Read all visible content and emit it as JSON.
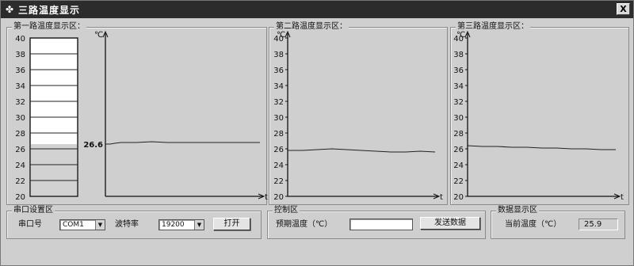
{
  "window": {
    "title": "三路温度显示",
    "close_label": "X",
    "icon": "app-logo-icon"
  },
  "panels": [
    {
      "label": "第一路温度显示区：",
      "unit": "℃",
      "axis_end": "t"
    },
    {
      "label": "第二路温度显示区：",
      "unit": "℃",
      "axis_end": "t"
    },
    {
      "label": "第三路温度显示区：",
      "unit": "℃",
      "axis_end": "t"
    }
  ],
  "thermometer": {
    "ticks": [
      "40",
      "38",
      "36",
      "34",
      "32",
      "30",
      "28",
      "26",
      "24",
      "22",
      "20"
    ],
    "level": 26.6,
    "min": 20,
    "max": 40
  },
  "current_marker": "26.6",
  "serial_settings": {
    "group_label": "串口设置区",
    "port_label": "串口号",
    "port_value": "COM1",
    "baud_label": "波特率",
    "baud_value": "19200",
    "open_button": "打开"
  },
  "control": {
    "group_label": "控制区",
    "setpoint_label": "预期温度（℃）",
    "setpoint_value": "",
    "send_button": "发送数据"
  },
  "data_display": {
    "group_label": "数据显示区",
    "current_label": "当前温度（℃）",
    "current_value": "25.9"
  },
  "chart_data": [
    {
      "type": "line",
      "title": "第一路温度显示区：",
      "ylabel": "℃",
      "xlabel": "t",
      "ylim": [
        20,
        40
      ],
      "yticks": [
        40,
        38,
        36,
        34,
        32,
        30,
        28,
        26,
        24,
        22,
        20
      ],
      "series": [
        {
          "x": [
            0,
            0.03,
            0.06,
            0.1,
            0.2,
            0.3,
            0.4,
            0.5,
            0.6,
            0.7,
            0.8,
            0.9,
            1.0
          ],
          "values": [
            26.6,
            26.6,
            26.7,
            26.8,
            26.8,
            26.9,
            26.8,
            26.8,
            26.8,
            26.8,
            26.8,
            26.8,
            26.8
          ]
        }
      ],
      "annotation": "26.6"
    },
    {
      "type": "line",
      "title": "第二路温度显示区：",
      "ylabel": "℃",
      "xlabel": "t",
      "ylim": [
        20,
        40
      ],
      "yticks": [
        40,
        38,
        36,
        34,
        32,
        30,
        28,
        26,
        24,
        22,
        20
      ],
      "series": [
        {
          "x": [
            0,
            0.1,
            0.2,
            0.3,
            0.4,
            0.5,
            0.6,
            0.7,
            0.8,
            0.9,
            1.0
          ],
          "values": [
            25.8,
            25.8,
            25.9,
            26.0,
            25.9,
            25.8,
            25.7,
            25.6,
            25.6,
            25.7,
            25.6
          ]
        }
      ]
    },
    {
      "type": "line",
      "title": "第三路温度显示区：",
      "ylabel": "℃",
      "xlabel": "t",
      "ylim": [
        20,
        40
      ],
      "yticks": [
        40,
        38,
        36,
        34,
        32,
        30,
        28,
        26,
        24,
        22,
        20
      ],
      "series": [
        {
          "x": [
            0,
            0.1,
            0.2,
            0.3,
            0.4,
            0.5,
            0.6,
            0.7,
            0.8,
            0.9,
            1.0
          ],
          "values": [
            26.4,
            26.3,
            26.3,
            26.2,
            26.2,
            26.1,
            26.1,
            26.0,
            26.0,
            25.9,
            25.9
          ]
        }
      ]
    }
  ]
}
